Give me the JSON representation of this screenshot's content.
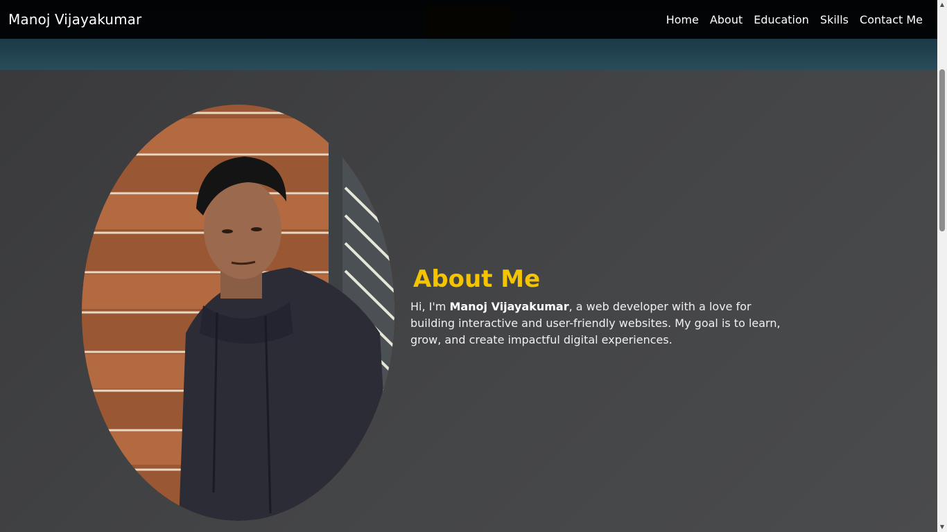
{
  "navbar": {
    "brand": "Manoj Vijayakumar",
    "links": [
      "Home",
      "About",
      "Education",
      "Skills",
      "Contact Me"
    ]
  },
  "about": {
    "title": "About Me",
    "intro": "Hi, I'm ",
    "name": "Manoj Vijayakumar",
    "body": ", a web developer with a love for building interactive and user-friendly websites. My goal is to learn, grow, and create impactful digital experiences."
  },
  "colors": {
    "accent": "#f5c400",
    "navbar_bg": "#000000",
    "section_bg": "#3b3c3e"
  },
  "icons": {
    "scroll_up": "triangle-up-icon",
    "scroll_down": "triangle-down-icon"
  }
}
